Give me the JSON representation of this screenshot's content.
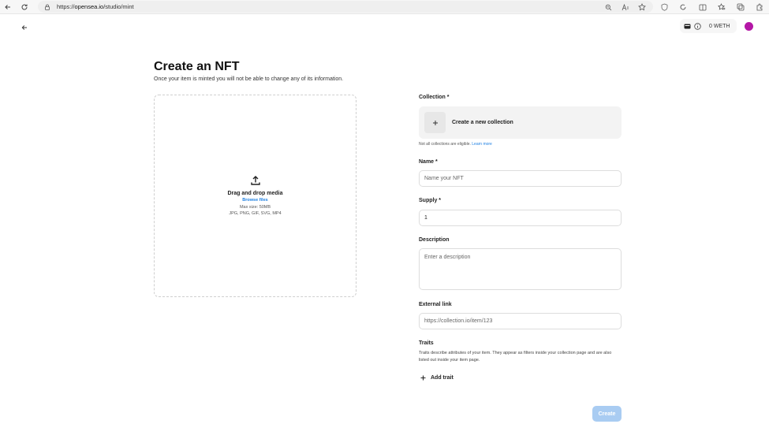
{
  "browser": {
    "url_prefix": "https://",
    "url_domain": "opensea.io",
    "url_path": "/studio/mint"
  },
  "header": {
    "wallet_balance": "0 WETH"
  },
  "page": {
    "title": "Create an NFT",
    "subtitle": "Once your item is minted you will not be able to change any of its information."
  },
  "dropzone": {
    "title": "Drag and drop media",
    "browse_label": "Browse files",
    "max_size": "Max size: 50MB",
    "formats": "JPG, PNG, GIF, SVG, MP4"
  },
  "form": {
    "collection_label": "Collection *",
    "create_collection_label": "Create a new collection",
    "collection_helper": "Not all collections are eligible.",
    "learn_more": "Learn more",
    "name_label": "Name *",
    "name_placeholder": "Name your NFT",
    "supply_label": "Supply *",
    "supply_value": "1",
    "description_label": "Description",
    "description_placeholder": "Enter a description",
    "external_link_label": "External link",
    "external_link_placeholder": "https://collection.io/item/123",
    "traits_label": "Traits",
    "traits_description": "Traits describe attributes of your item. They appear as filters inside your collection page and are also listed out inside your item page.",
    "add_trait_label": "Add trait",
    "create_button": "Create"
  },
  "colors": {
    "link": "#2081e2",
    "create_button_disabled": "#a9ccf2",
    "avatar": "#b417a6"
  }
}
